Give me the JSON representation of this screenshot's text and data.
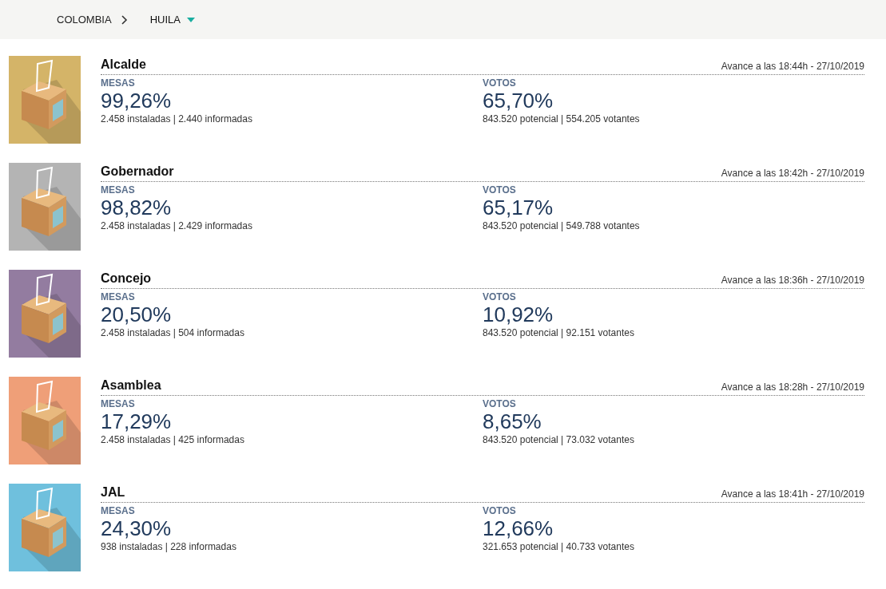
{
  "breadcrumb": [
    {
      "label": "COLOMBIA",
      "kind": "link"
    },
    {
      "label": "HUILA",
      "kind": "dropdown"
    }
  ],
  "elections": [
    {
      "title": "Alcalde",
      "color": "#d4b468",
      "updated": "Avance a las 18:44h - 27/10/2019",
      "mesas": {
        "label": "MESAS",
        "percent": "99,26%",
        "detail": "2.458 instaladas | 2.440 informadas"
      },
      "votos": {
        "label": "VOTOS",
        "percent": "65,70%",
        "detail": "843.520 potencial | 554.205 votantes"
      }
    },
    {
      "title": "Gobernador",
      "color": "#b4b4b4",
      "updated": "Avance a las 18:42h - 27/10/2019",
      "mesas": {
        "label": "MESAS",
        "percent": "98,82%",
        "detail": "2.458 instaladas | 2.429 informadas"
      },
      "votos": {
        "label": "VOTOS",
        "percent": "65,17%",
        "detail": "843.520 potencial | 549.788 votantes"
      }
    },
    {
      "title": "Concejo",
      "color": "#937ca0",
      "updated": "Avance a las 18:36h - 27/10/2019",
      "mesas": {
        "label": "MESAS",
        "percent": "20,50%",
        "detail": "2.458 instaladas | 504 informadas"
      },
      "votos": {
        "label": "VOTOS",
        "percent": "10,92%",
        "detail": "843.520 potencial | 92.151 votantes"
      }
    },
    {
      "title": "Asamblea",
      "color": "#ef9f78",
      "updated": "Avance a las 18:28h - 27/10/2019",
      "mesas": {
        "label": "MESAS",
        "percent": "17,29%",
        "detail": "2.458 instaladas | 425 informadas"
      },
      "votos": {
        "label": "VOTOS",
        "percent": "8,65%",
        "detail": "843.520 potencial | 73.032 votantes"
      }
    },
    {
      "title": "JAL",
      "color": "#6fc0dd",
      "updated": "Avance a las 18:41h - 27/10/2019",
      "mesas": {
        "label": "MESAS",
        "percent": "24,30%",
        "detail": "938 instaladas | 228 informadas"
      },
      "votos": {
        "label": "VOTOS",
        "percent": "12,66%",
        "detail": "321.653 potencial | 40.733 votantes"
      }
    }
  ]
}
